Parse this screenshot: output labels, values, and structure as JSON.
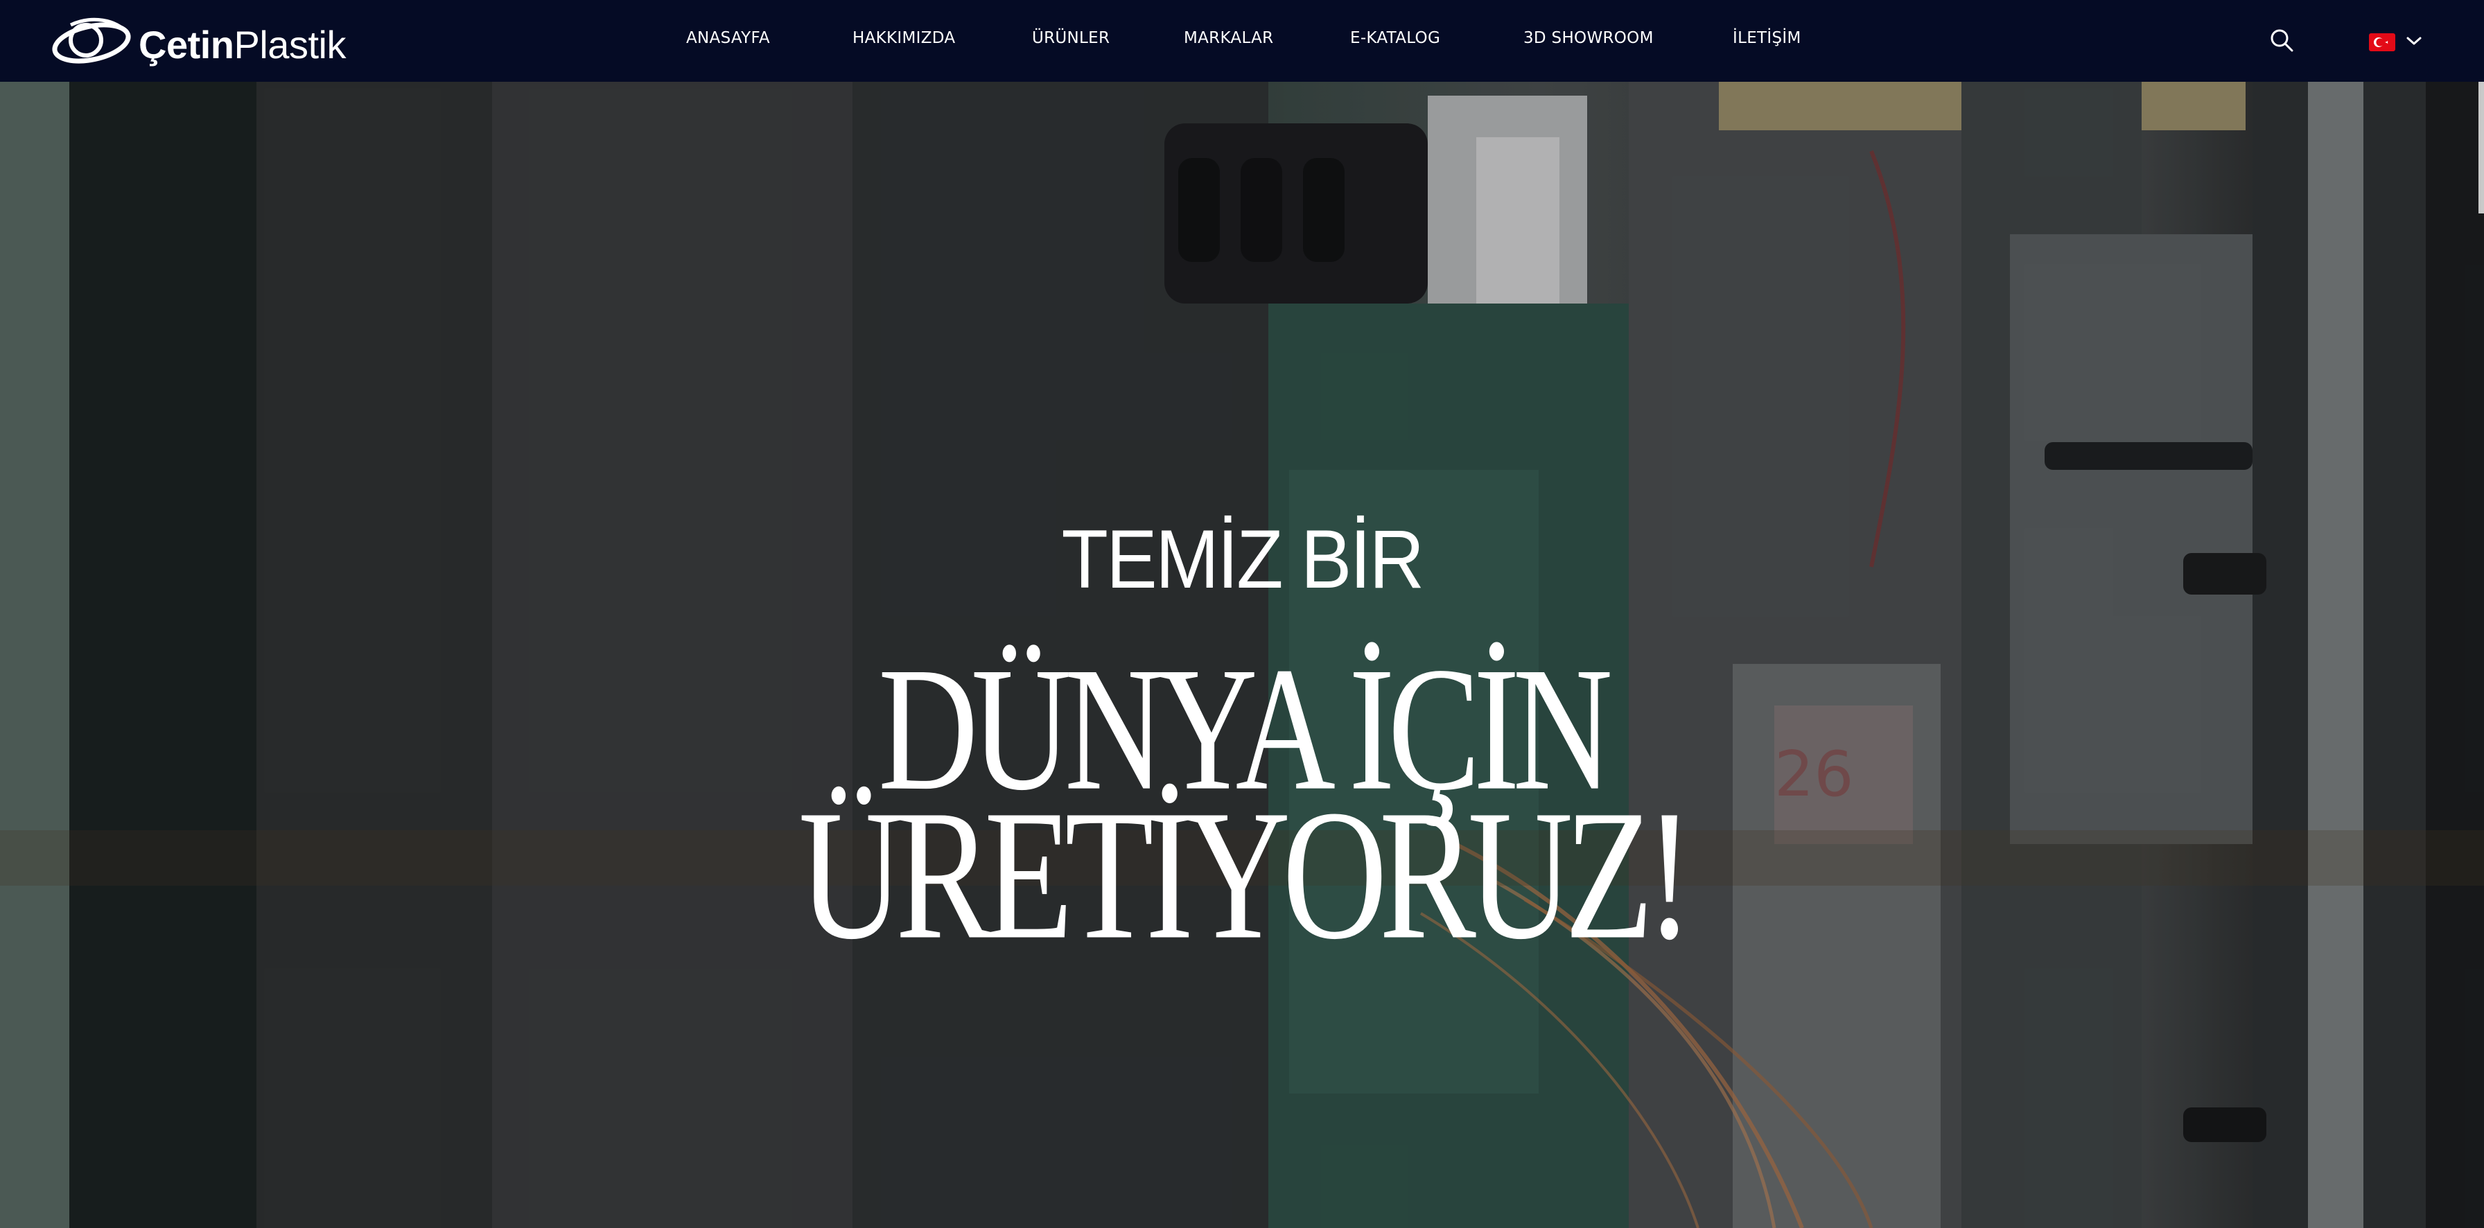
{
  "brand": {
    "name_bold": "Çetin",
    "name_light": "Plastik",
    "accent": "#050b25"
  },
  "nav": {
    "items": [
      {
        "label": "ANASAYFA"
      },
      {
        "label": "HAKKIMIZDA"
      },
      {
        "label": "ÜRÜNLER"
      },
      {
        "label": "MARKALAR"
      },
      {
        "label": "E-KATALOG"
      },
      {
        "label": "3D SHOWROOM"
      },
      {
        "label": "İLETİŞİM"
      }
    ],
    "search_icon": "search-icon",
    "language_flag": "turkey-flag-icon"
  },
  "hero": {
    "line_small": "TEMİZ BİR",
    "line_big_1": "DÜNYA İÇİN",
    "line_big_2": "ÜRETİYORUZ!"
  }
}
